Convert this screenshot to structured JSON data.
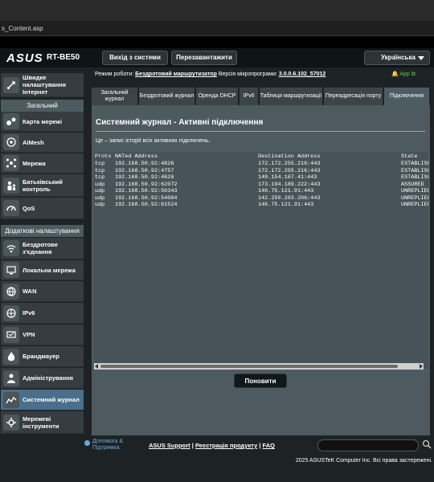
{
  "browser": {
    "url_fragment": "s_Content.asp"
  },
  "header": {
    "logo": "ASUS",
    "model": "RT-BE50",
    "logout_label": "Вихід з системи",
    "reboot_label": "Перезавантажити",
    "language": "Українська"
  },
  "status": {
    "mode_label": "Режим роботи:",
    "mode_value": "Бездротовий маршрутизатор",
    "fw_label": "Версія мікропрограми:",
    "fw_value": "3.0.0.6.102_57012",
    "app_label": "App"
  },
  "sidebar": {
    "quick": "Швидке налаштування Інтернет",
    "general_header": "Загальний",
    "general_items": [
      {
        "label": "Карта мережі",
        "icon": "network-map-icon"
      },
      {
        "label": "AiMesh",
        "icon": "aimesh-icon"
      },
      {
        "label": "Мережа",
        "icon": "network-icon"
      },
      {
        "label": "Батьківський контроль",
        "icon": "parental-control-icon"
      },
      {
        "label": "QoS",
        "icon": "qos-icon"
      }
    ],
    "advanced_header": "Додаткові налаштування",
    "advanced_items": [
      {
        "label": "Бездротове з'єднання",
        "icon": "wireless-icon"
      },
      {
        "label": "Локальна мережа",
        "icon": "lan-icon"
      },
      {
        "label": "WAN",
        "icon": "wan-icon"
      },
      {
        "label": "IPv6",
        "icon": "ipv6-icon"
      },
      {
        "label": "VPN",
        "icon": "vpn-icon"
      },
      {
        "label": "Брандмауер",
        "icon": "firewall-icon"
      },
      {
        "label": "Адміністрування",
        "icon": "administration-icon"
      },
      {
        "label": "Системний журнал",
        "icon": "system-log-icon"
      },
      {
        "label": "Мережеві інструменти",
        "icon": "network-tools-icon"
      }
    ]
  },
  "tabs": [
    "Загальний журнал",
    "Бездротовий журнал",
    "Оренда DHCP",
    "IPv6",
    "Таблиця маршрутизації",
    "Переадресація порту",
    "Підключення"
  ],
  "panel": {
    "title": "Системний журнал - Активні підключення",
    "description": "Це – запис історії всіх активних підключень.",
    "columns": [
      "Proto",
      "NATed Address",
      "Destination Address",
      "State"
    ],
    "rows": [
      [
        "tcp",
        "192.168.50.92:4826",
        "172.172.255.216:443",
        "ESTABLISHED"
      ],
      [
        "tcp",
        "192.168.50.92:4757",
        "172.172.255.216:443",
        "ESTABLISHED"
      ],
      [
        "tcp",
        "192.168.50.92:4626",
        "149.154.167.41:443",
        "ESTABLISHED"
      ],
      [
        "udp",
        "192.168.50.92:62072",
        "173.194.189.222:443",
        "ASSURED"
      ],
      [
        "udp",
        "192.168.50.92:50343",
        "146.75.121.91:443",
        "UNREPLIED"
      ],
      [
        "udp",
        "192.168.50.92:54084",
        "142.250.203.206:443",
        "UNREPLIED"
      ],
      [
        "udp",
        "192.168.50.92:61524",
        "146.75.121.91:443",
        "UNREPLIED"
      ]
    ],
    "refresh_label": "Поновити"
  },
  "footer": {
    "help_line1": "Допомога &",
    "help_line2": "Підтримка",
    "link_support": "ASUS Support",
    "link_register": "Реєстрація продукту",
    "link_faq": "FAQ",
    "separator": " | ",
    "copyright": "2025 ASUSTeK Computer Inc. Всі права застережені."
  }
}
